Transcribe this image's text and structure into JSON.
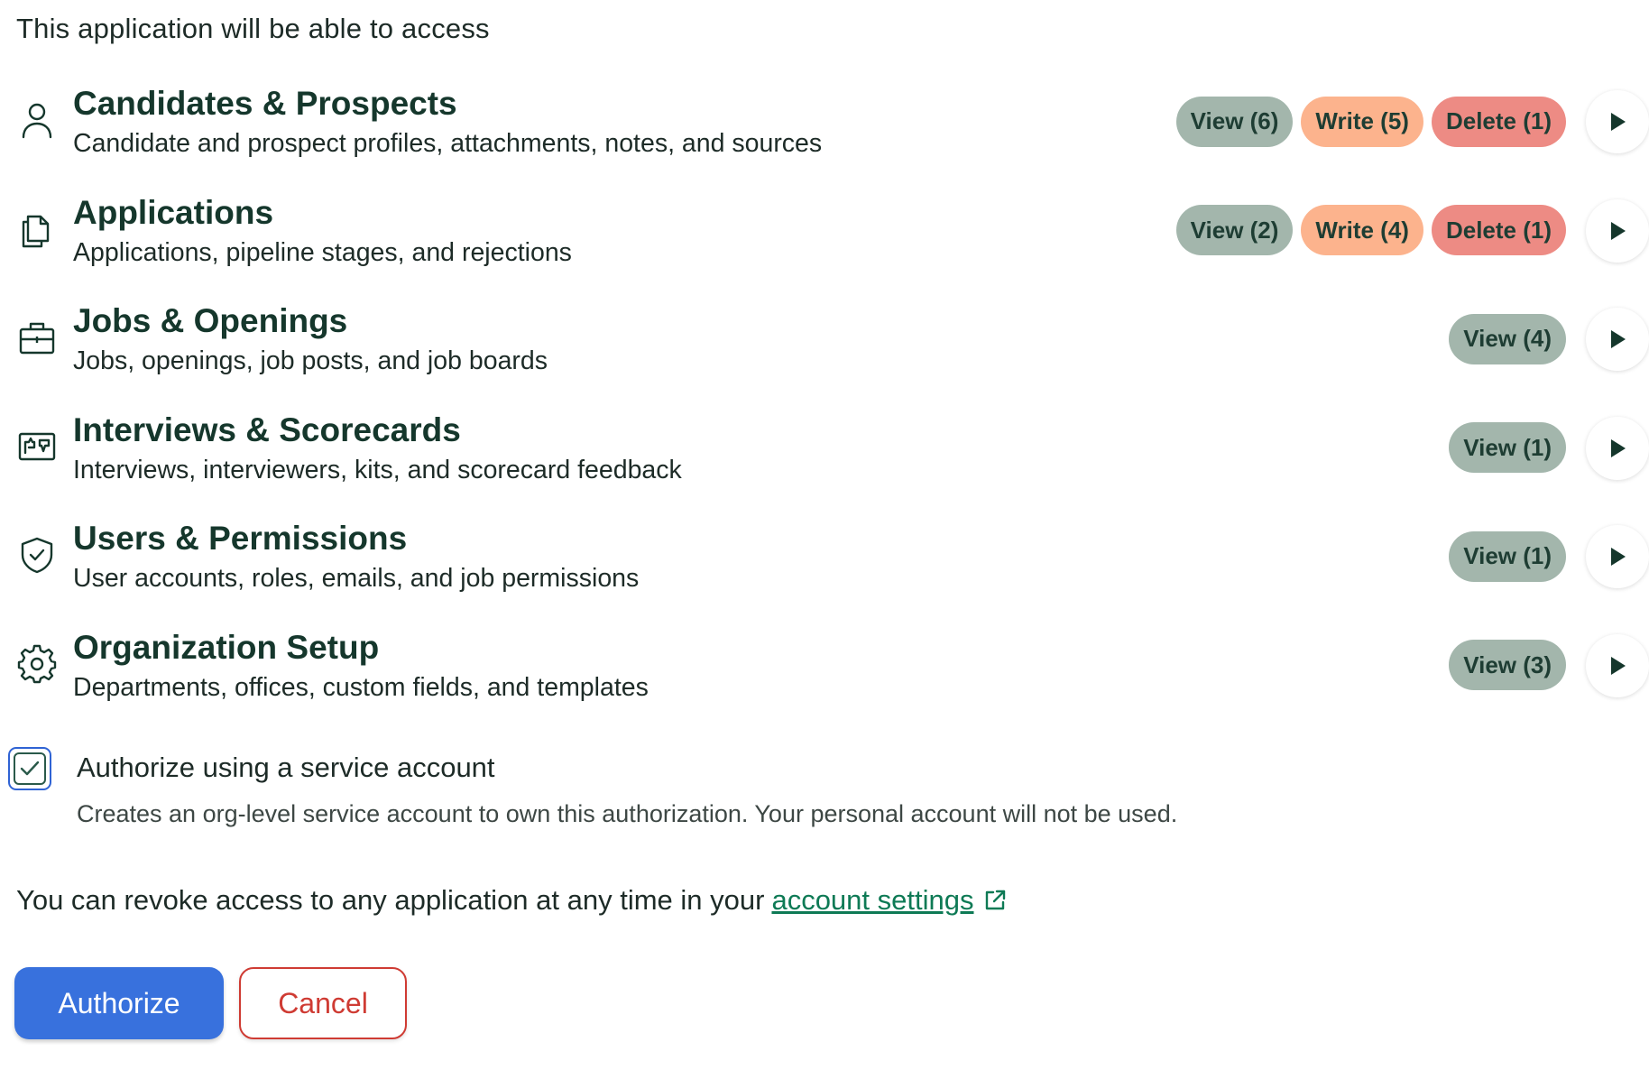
{
  "intro_text": "This application will be able to access",
  "scopes": [
    {
      "icon": "person-icon",
      "title": "Candidates & Prospects",
      "description": "Candidate and prospect profiles, attachments, notes, and sources",
      "badges": [
        {
          "type": "view",
          "label": "View (6)"
        },
        {
          "type": "write",
          "label": "Write (5)"
        },
        {
          "type": "delete",
          "label": "Delete (1)"
        }
      ]
    },
    {
      "icon": "documents-icon",
      "title": "Applications",
      "description": "Applications, pipeline stages, and rejections",
      "badges": [
        {
          "type": "view",
          "label": "View (2)"
        },
        {
          "type": "write",
          "label": "Write (4)"
        },
        {
          "type": "delete",
          "label": "Delete (1)"
        }
      ]
    },
    {
      "icon": "briefcase-icon",
      "title": "Jobs & Openings",
      "description": "Jobs, openings, job posts, and job boards",
      "badges": [
        {
          "type": "view",
          "label": "View (4)"
        }
      ]
    },
    {
      "icon": "scorecard-icon",
      "title": "Interviews & Scorecards",
      "description": "Interviews, interviewers, kits, and scorecard feedback",
      "badges": [
        {
          "type": "view",
          "label": "View (1)"
        }
      ]
    },
    {
      "icon": "shield-check-icon",
      "title": "Users & Permissions",
      "description": "User accounts, roles, emails, and job permissions",
      "badges": [
        {
          "type": "view",
          "label": "View (1)"
        }
      ]
    },
    {
      "icon": "gear-icon",
      "title": "Organization Setup",
      "description": "Departments, offices, custom fields, and templates",
      "badges": [
        {
          "type": "view",
          "label": "View (3)"
        }
      ]
    }
  ],
  "service_account": {
    "checked": true,
    "label": "Authorize using a service account",
    "description": "Creates an org-level service account to own this authorization. Your personal account will not be used."
  },
  "revoke": {
    "text": "You can revoke access to any application at any time in your",
    "link_label": "account settings",
    "link_icon": "external-link-icon"
  },
  "actions": {
    "authorize_label": "Authorize",
    "cancel_label": "Cancel"
  },
  "colors": {
    "view_badge": "#a3b6ac",
    "write_badge": "#fcb38d",
    "delete_badge": "#ed8b84",
    "primary": "#3871dd",
    "danger": "#cf3b33",
    "link": "#0e7a55",
    "heading": "#15372c"
  }
}
